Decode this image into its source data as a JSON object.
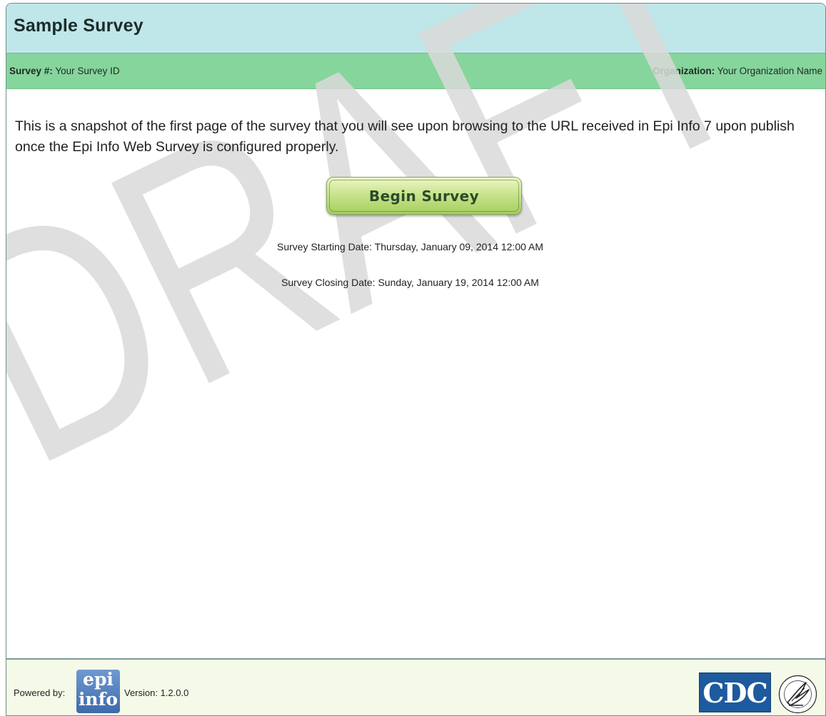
{
  "header": {
    "title": "Sample Survey"
  },
  "info": {
    "survey_label": "Survey #:",
    "survey_value": "Your Survey ID",
    "org_label": "Organization:",
    "org_value": "Your Organization Name"
  },
  "main": {
    "intro": "This is a snapshot of the first page of the survey that you will see upon browsing to the URL received in Epi Info 7 upon publish once the Epi Info Web Survey is configured properly.",
    "begin_button": "Begin Survey",
    "start_date": "Survey Starting Date: Thursday, January 09, 2014 12:00 AM",
    "closing_date": "Survey Closing Date: Sunday, January 19, 2014 12:00 AM",
    "watermark": "DRAFT"
  },
  "footer": {
    "powered_by": "Powered by:",
    "epi_logo_line1": "epi",
    "epi_logo_line2": "info",
    "version": "Version: 1.2.0.0",
    "cdc_logo": "CDC"
  },
  "colors": {
    "title_bar": "#bfe6e8",
    "info_bar": "#86d59c",
    "footer": "#f5fae8",
    "button": "#c9e48d"
  },
  "icons": {
    "epi_info_logo": "epi-info-logo",
    "cdc_logo": "cdc-logo",
    "hhs_logo": "hhs-eagle-logo"
  }
}
